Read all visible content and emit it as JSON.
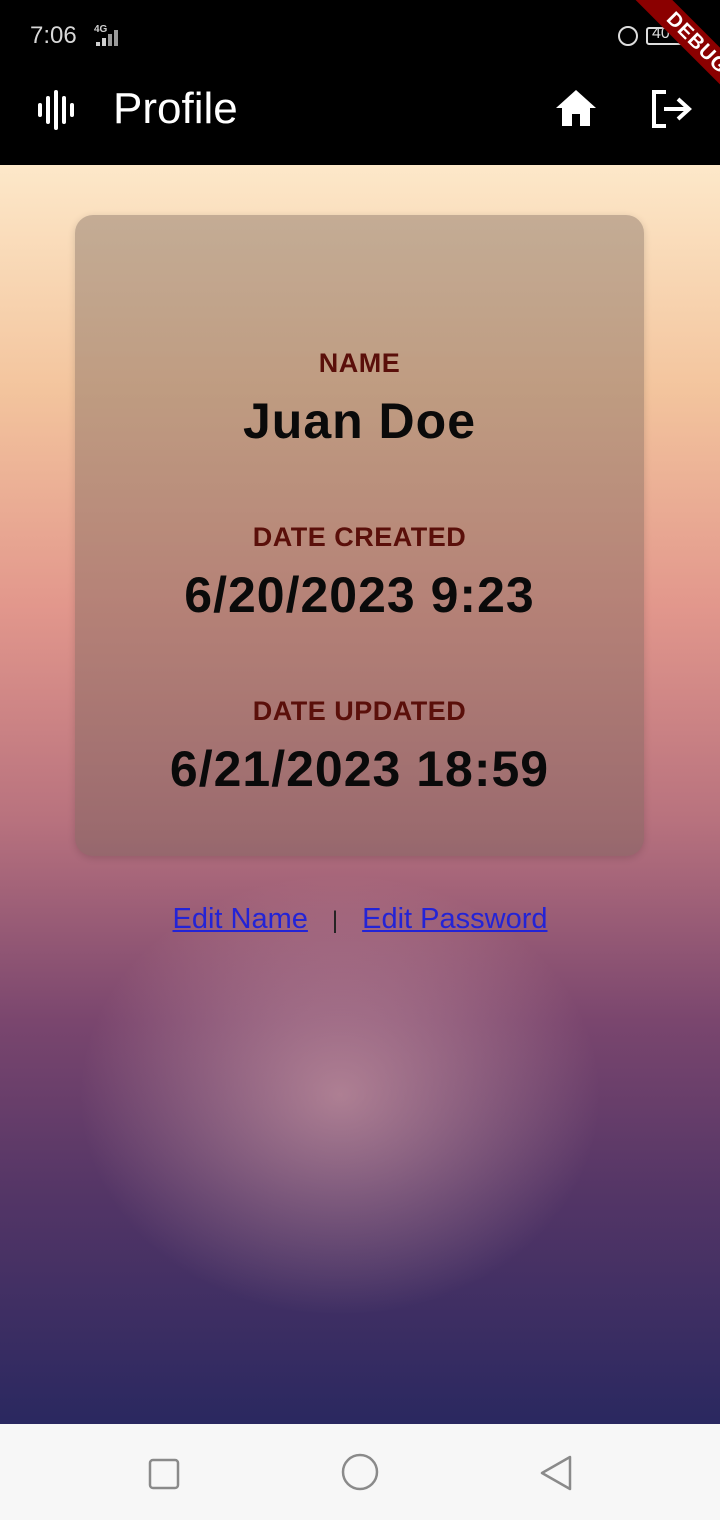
{
  "status_bar": {
    "time": "7:06",
    "network_label": "4G",
    "battery_text": "40"
  },
  "debug_banner": "DEBUG",
  "app_bar": {
    "title": "Profile",
    "logo_icon": "audio-waveform-icon",
    "home_icon": "home-icon",
    "logout_icon": "logout-icon"
  },
  "profile": {
    "name_label": "NAME",
    "name_value": "Juan Doe",
    "created_label": "DATE CREATED",
    "created_value": "6/20/2023 9:23",
    "updated_label": "DATE UPDATED",
    "updated_value": "6/21/2023 18:59"
  },
  "links": {
    "edit_name": "Edit Name",
    "separator": "|",
    "edit_password": "Edit Password"
  },
  "nav": {
    "recent": "square-icon",
    "home": "circle-icon",
    "back": "triangle-back-icon"
  },
  "colors": {
    "label": "#5a0f0a",
    "link": "#2323d6",
    "debug": "#8b0000"
  }
}
